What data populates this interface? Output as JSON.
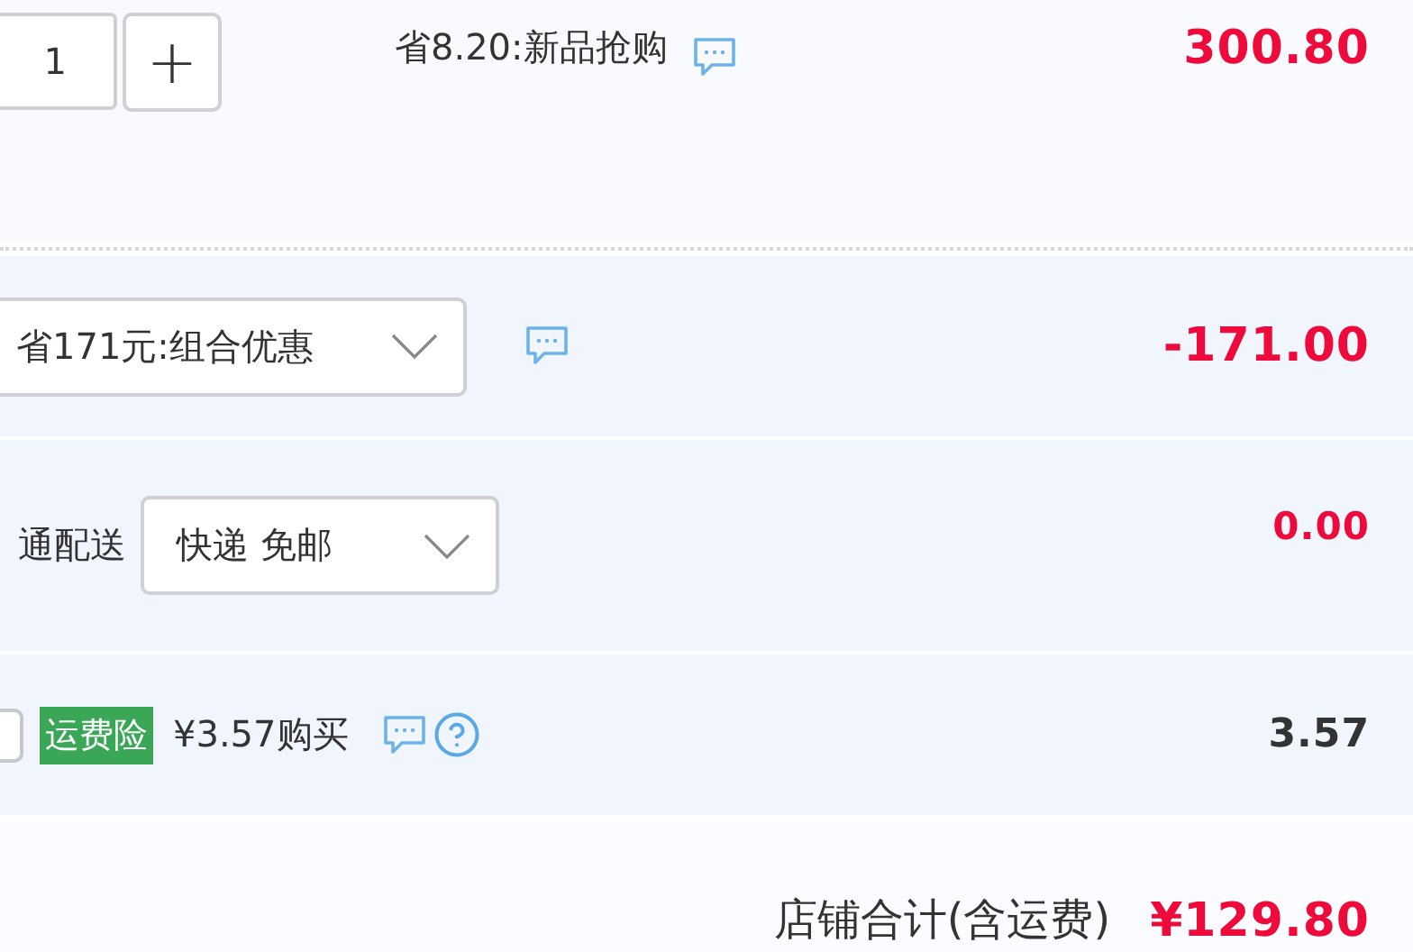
{
  "item": {
    "quantity": "1",
    "plus": "+",
    "promo": "省8.20:新品抢购",
    "price": "300.80"
  },
  "discount": {
    "selected_option": "省171元:组合优惠",
    "price": "-171.00"
  },
  "delivery": {
    "label": "通配送",
    "selected_option": "快递 免邮",
    "price": "0.00"
  },
  "insurance": {
    "checked": false,
    "tag": "运费险",
    "offer": "¥3.57购买",
    "price": "3.57"
  },
  "total": {
    "label": "店铺合计(含运费)",
    "amount": "¥129.80"
  }
}
